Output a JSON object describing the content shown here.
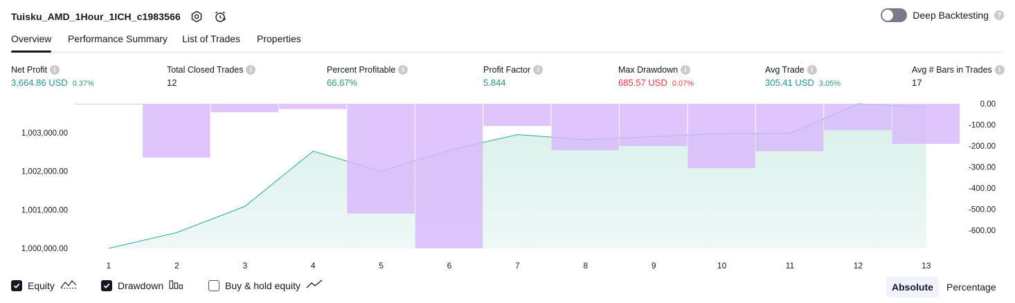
{
  "header": {
    "strategy_name": "Tuisku_AMD_1Hour_1ICH_c1983566",
    "settings_icon": "gear-icon",
    "alert_icon": "alarm-clock-icon",
    "deep_backtesting_label": "Deep Backtesting",
    "deep_backtesting_on": false
  },
  "tabs": [
    {
      "label": "Overview",
      "active": true
    },
    {
      "label": "Performance Summary",
      "active": false
    },
    {
      "label": "List of Trades",
      "active": false
    },
    {
      "label": "Properties",
      "active": false
    }
  ],
  "metrics": [
    {
      "label": "Net Profit",
      "value": "3,664.86",
      "unit": "USD",
      "pct": "0.37%",
      "color": "green"
    },
    {
      "label": "Total Closed Trades",
      "value": "12",
      "unit": "",
      "pct": "",
      "color": "dark"
    },
    {
      "label": "Percent Profitable",
      "value": "66.67%",
      "unit": "",
      "pct": "",
      "color": "green"
    },
    {
      "label": "Profit Factor",
      "value": "5.844",
      "unit": "",
      "pct": "",
      "color": "green"
    },
    {
      "label": "Max Drawdown",
      "value": "685.57",
      "unit": "USD",
      "pct": "0.07%",
      "color": "red"
    },
    {
      "label": "Avg Trade",
      "value": "305.41",
      "unit": "USD",
      "pct": "3.05%",
      "color": "green"
    },
    {
      "label": "Avg # Bars in Trades",
      "value": "17",
      "unit": "",
      "pct": "",
      "color": "dark"
    }
  ],
  "chart_data": {
    "type": "area",
    "x": [
      1,
      2,
      3,
      4,
      5,
      6,
      7,
      8,
      9,
      10,
      11,
      12,
      13
    ],
    "series": [
      {
        "name": "Equity",
        "values": [
          1000000,
          1000410,
          1001090,
          1002520,
          1002000,
          1002550,
          1002950,
          1002820,
          1002900,
          1002980,
          1002980,
          1003750,
          1003660
        ]
      },
      {
        "name": "Drawdown",
        "values": [
          0,
          -255,
          -40,
          -25,
          -520,
          -685,
          -105,
          -220,
          -200,
          -305,
          -225,
          -125,
          -190
        ]
      }
    ],
    "y_left": {
      "ticks": [
        "1,000,000.00",
        "1,001,000.00",
        "1,002,000.00",
        "1,003,000.00"
      ],
      "range": [
        1000000,
        1003750
      ]
    },
    "y_right": {
      "ticks": [
        "0.00",
        "-100.00",
        "-200.00",
        "-300.00",
        "-400.00",
        "-500.00",
        "-600.00"
      ],
      "range": [
        -685,
        0
      ]
    },
    "colors": {
      "equity_line": "#22ab94",
      "equity_fill": "#d4efe9",
      "drawdown_fill": "#d9b8fb"
    }
  },
  "legend": [
    {
      "label": "Equity",
      "checked": true,
      "icon": "equity-line-icon"
    },
    {
      "label": "Drawdown",
      "checked": true,
      "icon": "drawdown-bars-icon"
    },
    {
      "label": "Buy & hold equity",
      "checked": false,
      "icon": "buy-hold-line-icon"
    }
  ],
  "view_mode": {
    "options": [
      "Absolute",
      "Percentage"
    ],
    "selected": "Absolute"
  }
}
